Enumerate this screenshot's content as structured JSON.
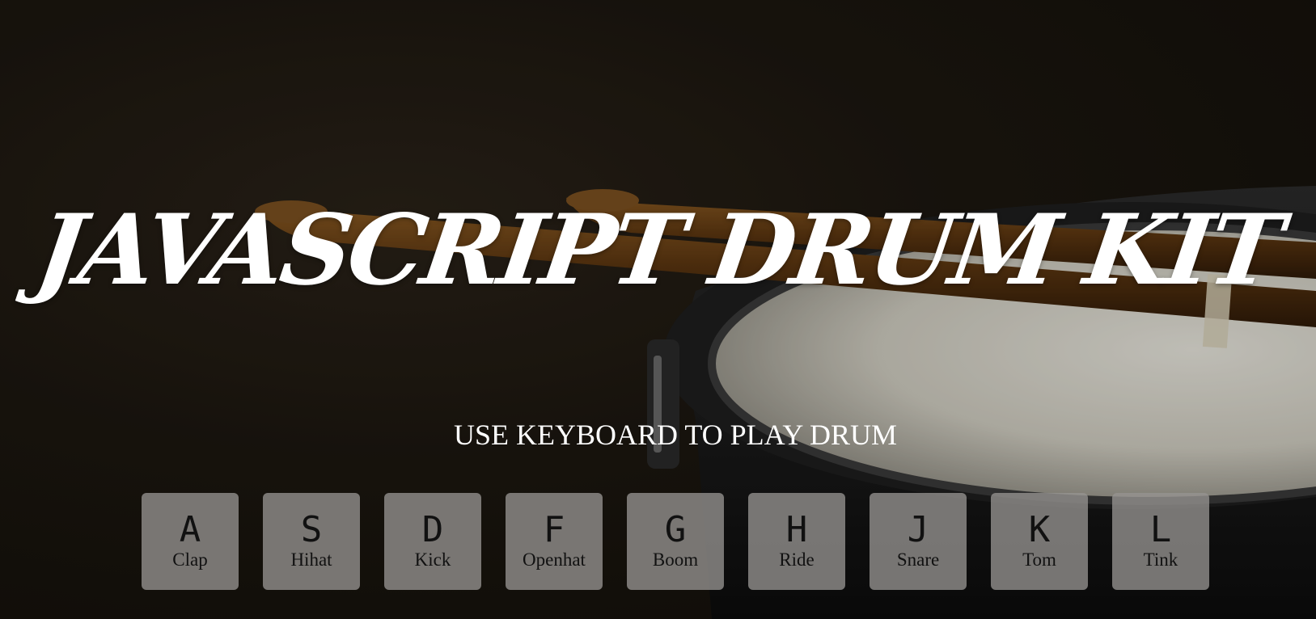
{
  "header": {
    "title": "JAVASCRIPT DRUM KIT",
    "subtitle": "USE KEYBOARD TO PLAY DRUM"
  },
  "keys": [
    {
      "letter": "A",
      "sound": "Clap"
    },
    {
      "letter": "S",
      "sound": "Hihat"
    },
    {
      "letter": "D",
      "sound": "Kick"
    },
    {
      "letter": "F",
      "sound": "Openhat"
    },
    {
      "letter": "G",
      "sound": "Boom"
    },
    {
      "letter": "H",
      "sound": "Ride"
    },
    {
      "letter": "J",
      "sound": "Snare"
    },
    {
      "letter": "K",
      "sound": "Tom"
    },
    {
      "letter": "L",
      "sound": "Tink"
    }
  ],
  "colors": {
    "background": "#1b160f",
    "title": "#ffffff",
    "key_bg": "#969491",
    "key_text": "#111111"
  }
}
